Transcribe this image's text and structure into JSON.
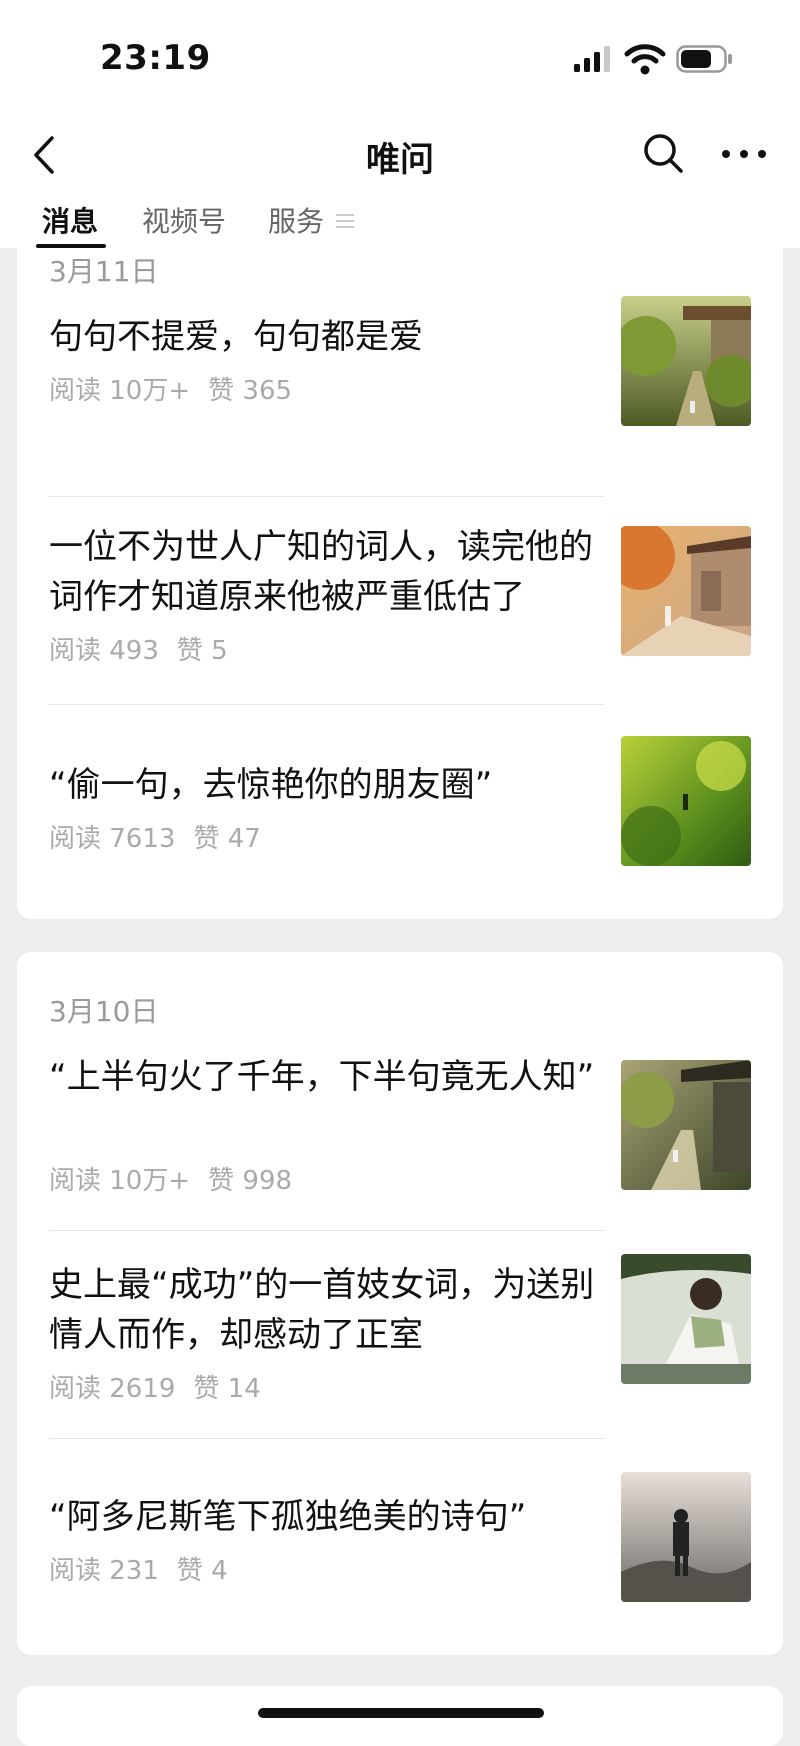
{
  "status": {
    "time": "23:19"
  },
  "nav": {
    "title": "唯问",
    "back_icon": "chevron-left-icon",
    "search_icon": "search-icon",
    "more_icon": "more-dots-icon"
  },
  "tabs": [
    {
      "label": "消息",
      "active": true
    },
    {
      "label": "视频号",
      "active": false
    },
    {
      "label": "服务",
      "active": false
    }
  ],
  "groups": [
    {
      "date": "3月11日",
      "articles": [
        {
          "title": "句句不提爱，句句都是爱",
          "reads": "阅读 10万+",
          "likes": "赞 365"
        },
        {
          "title": "一位不为世人广知的词人，读完他的词作才知道原来他被严重低估了",
          "reads": "阅读 493",
          "likes": "赞 5"
        },
        {
          "title": "“偷一句，去惊艳你的朋友圈”",
          "reads": "阅读 7613",
          "likes": "赞 47"
        }
      ]
    },
    {
      "date": "3月10日",
      "articles": [
        {
          "title": "“上半句火了千年，下半句竟无人知”",
          "reads": "阅读 10万+",
          "likes": "赞 998"
        },
        {
          "title": "史上最“成功”的一首妓女词，为送别情人而作，却感动了正室",
          "reads": "阅读 2619",
          "likes": "赞 14"
        },
        {
          "title": "“阿多尼斯笔下孤独绝美的诗句”",
          "reads": "阅读 231",
          "likes": "赞 4"
        }
      ]
    }
  ]
}
